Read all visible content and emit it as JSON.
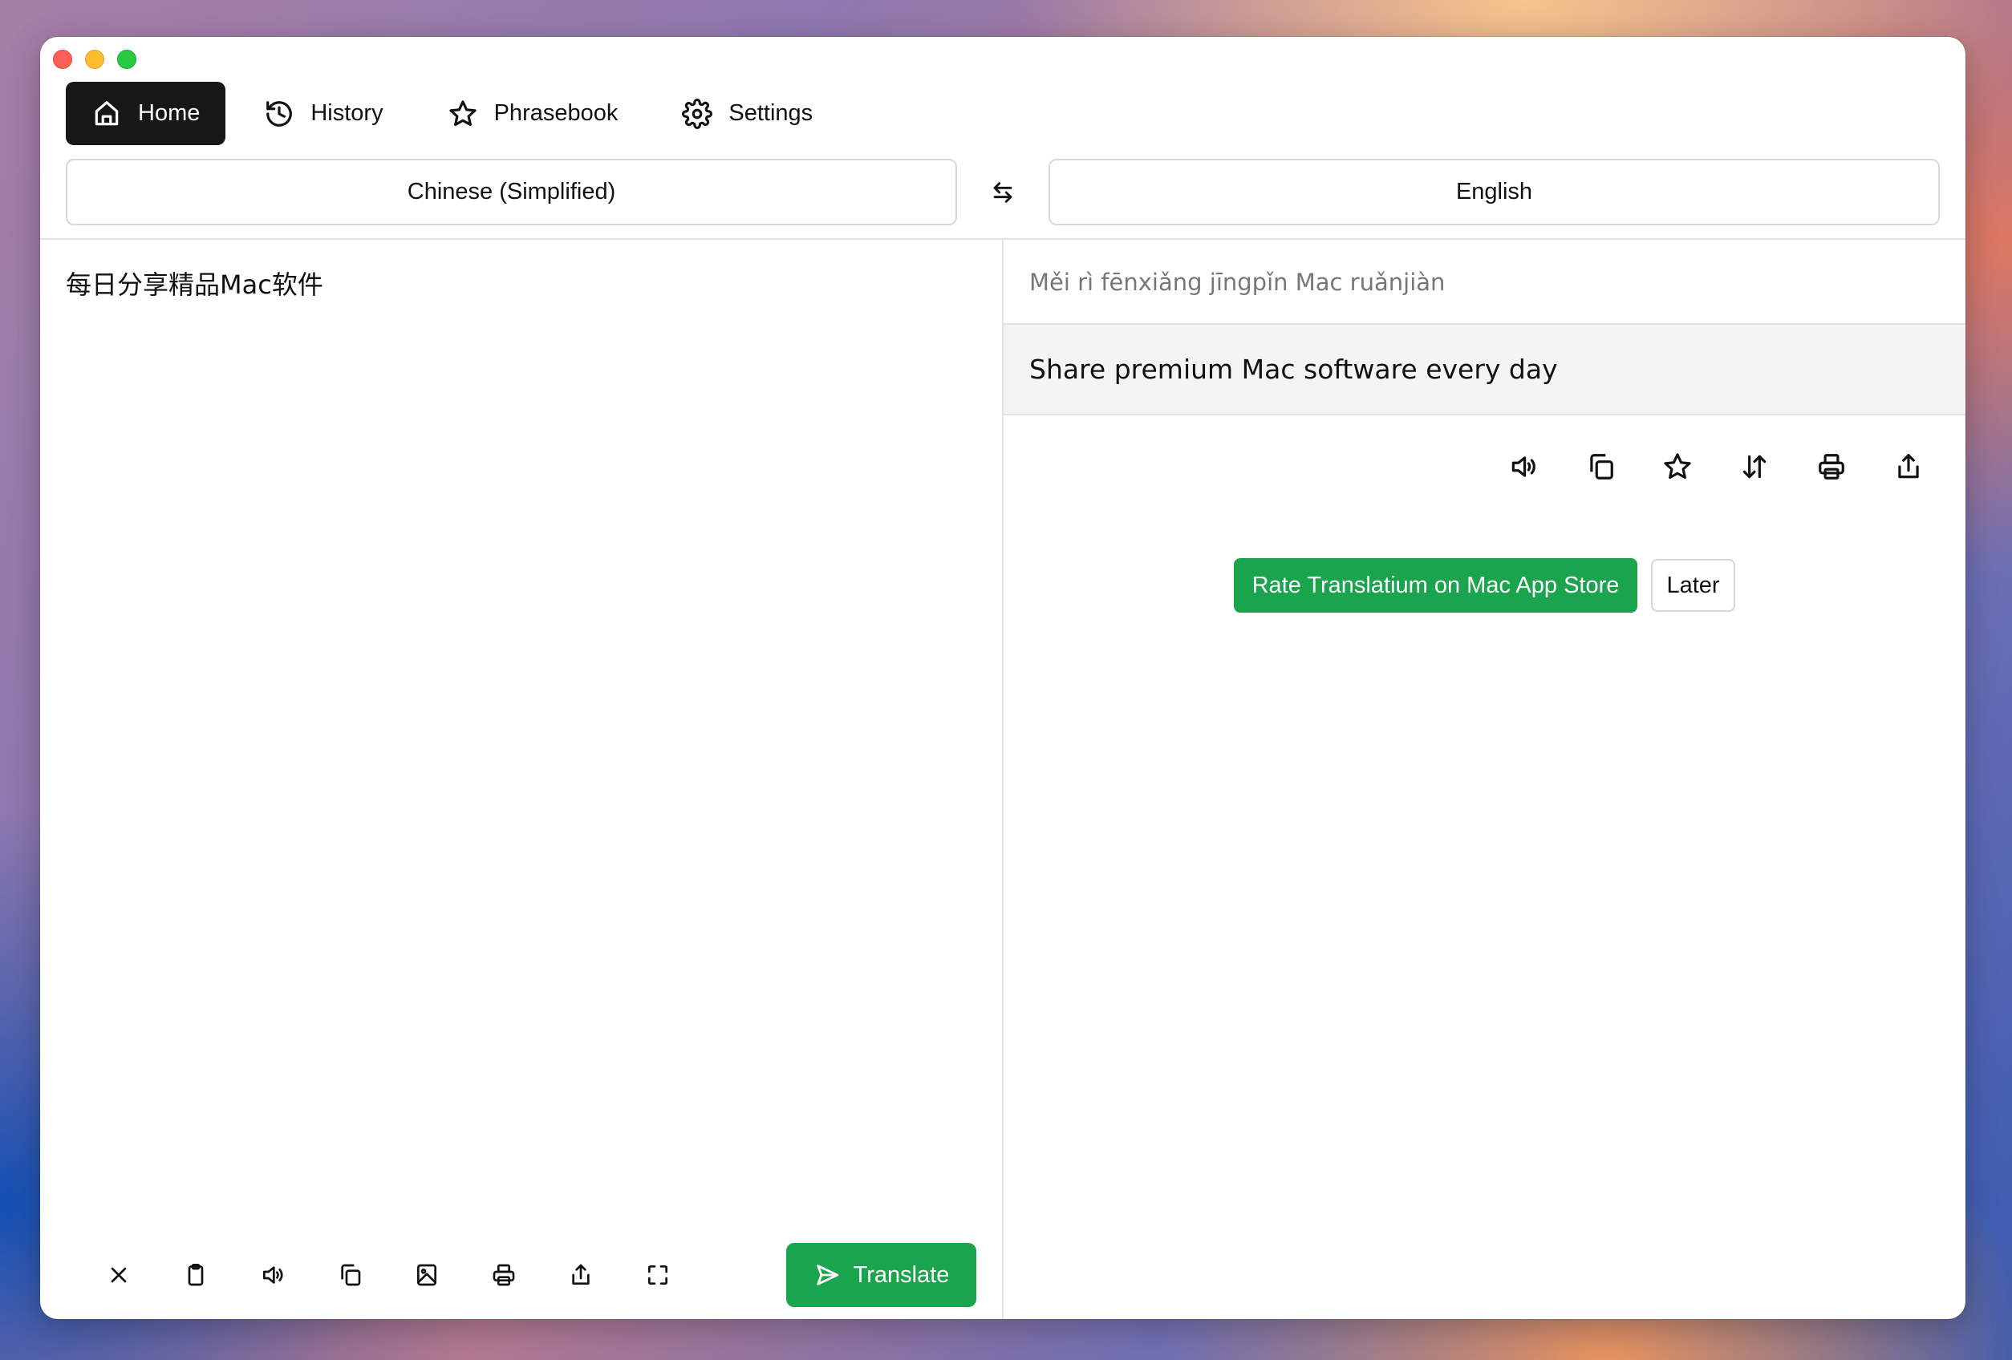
{
  "app": {
    "window_controls": [
      "close",
      "minimize",
      "maximize"
    ]
  },
  "nav": {
    "items": [
      {
        "label": "Home",
        "icon": "home-icon",
        "active": true
      },
      {
        "label": "History",
        "icon": "history-icon",
        "active": false
      },
      {
        "label": "Phrasebook",
        "icon": "star-icon",
        "active": false
      },
      {
        "label": "Settings",
        "icon": "gear-icon",
        "active": false
      }
    ]
  },
  "languages": {
    "source": "Chinese (Simplified)",
    "target": "English",
    "swap_icon": "swap-arrows-icon"
  },
  "source": {
    "text": "每日分享精品Mac软件",
    "toolbar": [
      {
        "name": "clear",
        "icon": "close-icon"
      },
      {
        "name": "paste",
        "icon": "clipboard-icon"
      },
      {
        "name": "speak",
        "icon": "speaker-icon"
      },
      {
        "name": "copy",
        "icon": "copy-icon"
      },
      {
        "name": "image",
        "icon": "image-icon"
      },
      {
        "name": "print",
        "icon": "printer-icon"
      },
      {
        "name": "share",
        "icon": "share-icon"
      },
      {
        "name": "fullscreen",
        "icon": "expand-icon"
      }
    ],
    "translate_label": "Translate"
  },
  "result": {
    "pinyin": "Měi rì fēnxiǎng jīngpǐn Mac ruǎnjiàn",
    "translation": "Share premium Mac software every day",
    "toolbar": [
      {
        "name": "speak",
        "icon": "speaker-icon"
      },
      {
        "name": "copy",
        "icon": "copy-icon"
      },
      {
        "name": "favorite",
        "icon": "star-icon"
      },
      {
        "name": "swap",
        "icon": "sort-arrows-icon"
      },
      {
        "name": "print",
        "icon": "printer-icon"
      },
      {
        "name": "share",
        "icon": "share-icon"
      }
    ]
  },
  "rating": {
    "rate_label": "Rate Translatium on Mac App Store",
    "later_label": "Later"
  },
  "colors": {
    "accent_green": "#1aa44d",
    "active_tab": "#171717"
  }
}
